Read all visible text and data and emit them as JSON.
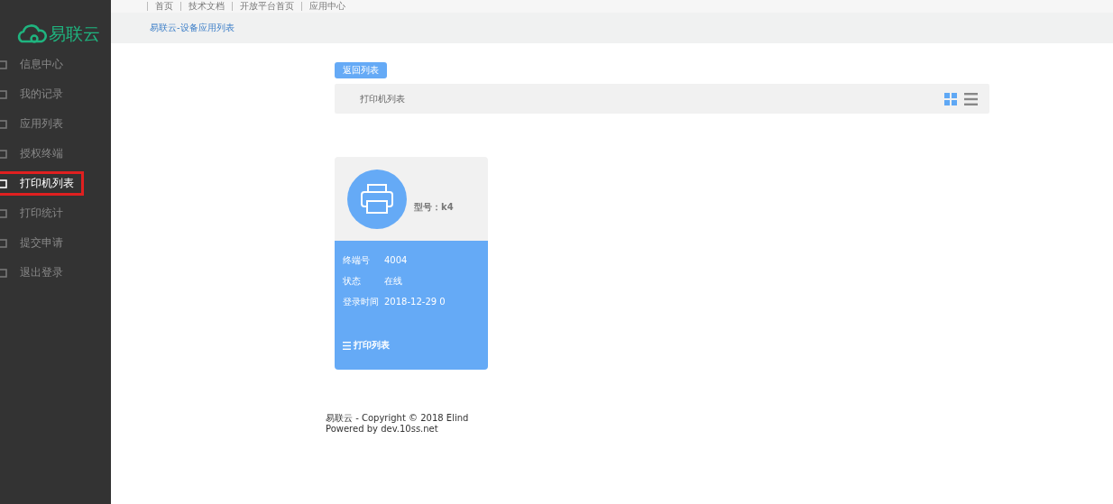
{
  "logo": {
    "text": "易联云"
  },
  "top_nav": [
    "首页",
    "技术文档",
    "开放平台首页",
    "应用中心"
  ],
  "sidebar": {
    "items": [
      {
        "label": "信息中心",
        "selected": false
      },
      {
        "label": "我的记录",
        "selected": false
      },
      {
        "label": "应用列表",
        "selected": false
      },
      {
        "label": "授权终端",
        "selected": false
      },
      {
        "label": "打印机列表",
        "selected": true
      },
      {
        "label": "打印统计",
        "selected": false
      },
      {
        "label": "提交申请",
        "selected": false
      },
      {
        "label": "退出登录",
        "selected": false
      }
    ]
  },
  "breadcrumb": "易联云-设备应用列表",
  "back_button": "返回列表",
  "panel": {
    "title": "打印机列表",
    "views": [
      {
        "kind": "grid",
        "selected": true
      },
      {
        "kind": "list",
        "selected": false
      }
    ]
  },
  "device": {
    "model": "型号：k4",
    "fields": [
      {
        "label": "终端号",
        "value": "4004"
      },
      {
        "label": "状态",
        "value": "在线"
      },
      {
        "label": "登录时间",
        "value": "2018-12-29 0"
      }
    ],
    "link": "打印列表"
  },
  "footer": [
    "易联云 - Copyright © 2018 Elind",
    "Powered by dev.10ss.net"
  ]
}
